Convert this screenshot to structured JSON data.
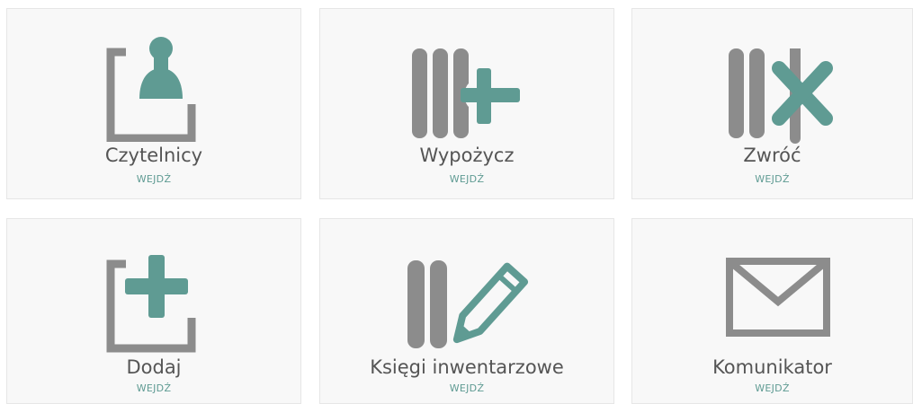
{
  "colors": {
    "accent": "#5f9b93",
    "icon_gray": "#8c8c8c",
    "tile_bg": "#f8f8f8",
    "title_text": "#555555"
  },
  "tiles": [
    {
      "title": "Czytelnicy",
      "action": "WEJDŹ",
      "icon": "reader-person-icon"
    },
    {
      "title": "Wypożycz",
      "action": "WEJDŹ",
      "icon": "books-plus-icon"
    },
    {
      "title": "Zwróć",
      "action": "WEJDŹ",
      "icon": "books-cross-icon"
    },
    {
      "title": "Dodaj",
      "action": "WEJDŹ",
      "icon": "add-plus-icon"
    },
    {
      "title": "Księgi inwentarzowe",
      "action": "WEJDŹ",
      "icon": "books-pencil-icon"
    },
    {
      "title": "Komunikator",
      "action": "WEJDŹ",
      "icon": "envelope-icon"
    }
  ]
}
